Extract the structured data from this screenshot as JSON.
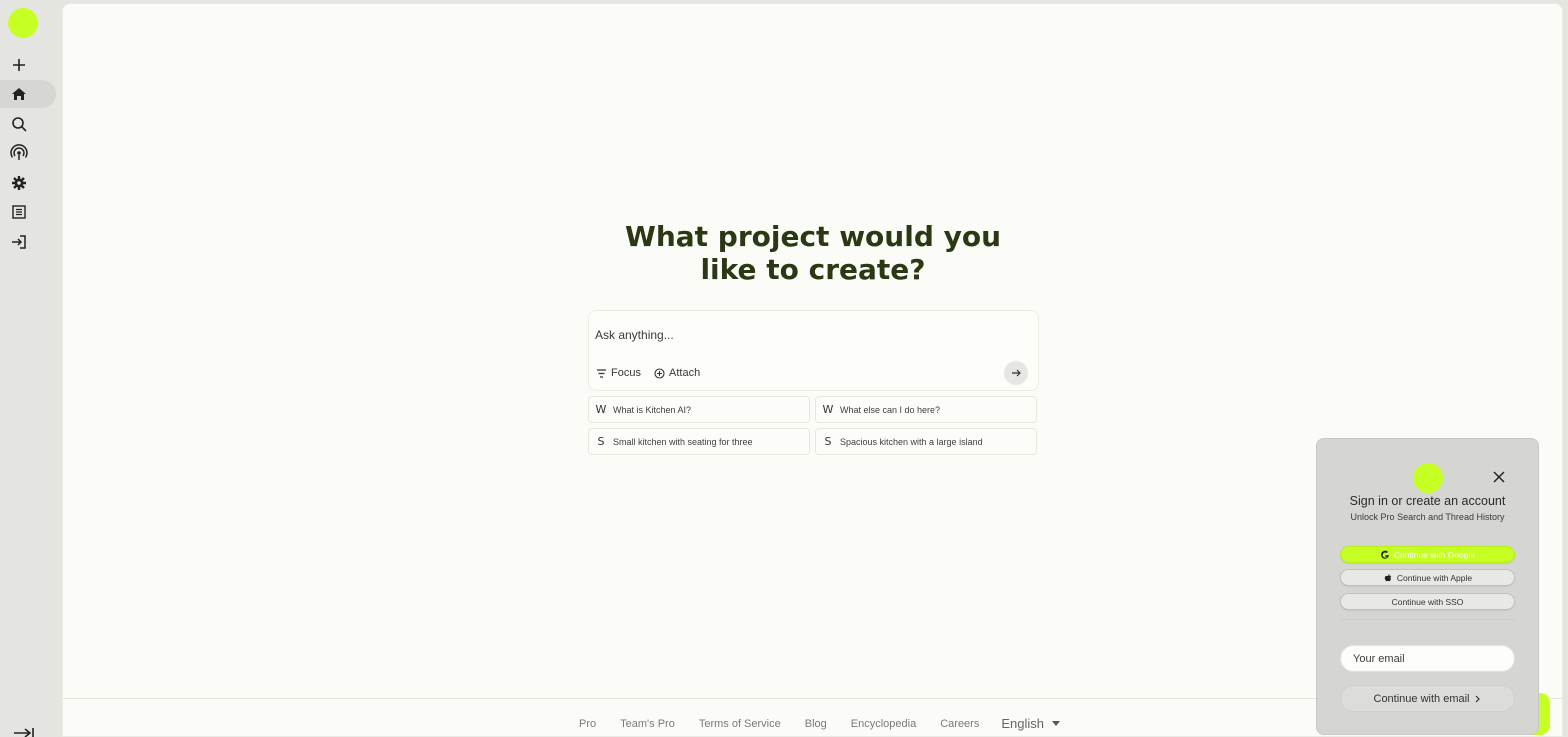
{
  "brand": {
    "accent": "#c6ff23",
    "title_color": "#2a3914"
  },
  "sidebar": {
    "items": [
      {
        "name": "new-thread",
        "icon": "plus-icon"
      },
      {
        "name": "home",
        "icon": "home-icon",
        "active": true
      },
      {
        "name": "search",
        "icon": "search-icon"
      },
      {
        "name": "discover",
        "icon": "broadcast-icon"
      },
      {
        "name": "settings",
        "icon": "gear-icon"
      },
      {
        "name": "library",
        "icon": "list-icon"
      },
      {
        "name": "sign-in",
        "icon": "login-icon"
      }
    ],
    "collapse_icon": "collapse-arrow-icon"
  },
  "main": {
    "heading": "What project would you like to create?",
    "composer": {
      "placeholder": "Ask anything...",
      "focus_label": "Focus",
      "attach_label": "Attach"
    },
    "suggestions": [
      {
        "letter": "W",
        "text": "What is Kitchen AI?"
      },
      {
        "letter": "W",
        "text": "What else can I do here?"
      },
      {
        "letter": "S",
        "text": "Small kitchen with seating for three"
      },
      {
        "letter": "S",
        "text": "Spacious kitchen with a large island"
      }
    ]
  },
  "footer": {
    "links": [
      "Pro",
      "Team's Pro",
      "Terms of Service",
      "Blog",
      "Encyclopedia",
      "Careers"
    ],
    "language": "English"
  },
  "auth_modal": {
    "title": "Sign in or create an account",
    "subtitle": "Unlock Pro Search and Thread History",
    "google_label": "Continue with Google",
    "apple_label": "Continue with Apple",
    "sso_label": "Continue with SSO",
    "email_placeholder": "Your email",
    "continue_email_label": "Continue with email"
  }
}
